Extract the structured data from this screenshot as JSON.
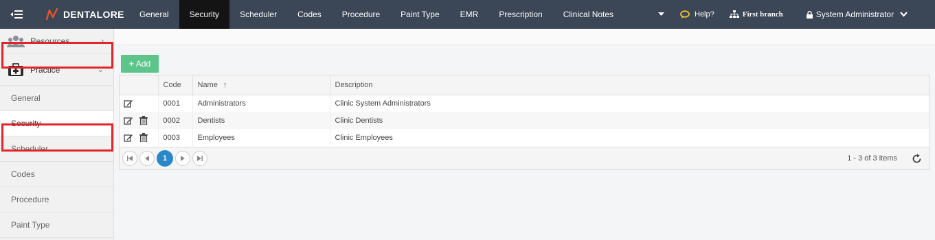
{
  "app": {
    "brand": "DENTALORE",
    "colors": {
      "topbar": "#3b4656",
      "active_tab": "#141414",
      "accent_green": "#5cc58a",
      "pager_active": "#2b88c8",
      "highlight": "#e3242b"
    }
  },
  "nav": {
    "tabs": [
      {
        "label": "General",
        "active": false
      },
      {
        "label": "Security",
        "active": true
      },
      {
        "label": "Scheduler",
        "active": false
      },
      {
        "label": "Codes",
        "active": false
      },
      {
        "label": "Procedure",
        "active": false
      },
      {
        "label": "Paint Type",
        "active": false
      },
      {
        "label": "EMR",
        "active": false
      },
      {
        "label": "Prescription",
        "active": false
      },
      {
        "label": "Clinical Notes",
        "active": false
      }
    ],
    "help_label": "Help?",
    "branch_label": "First branch",
    "user_label": "System Administrator"
  },
  "sidebar": {
    "groups": [
      {
        "label": "Resources",
        "icon": "users-icon",
        "expanded": false
      },
      {
        "label": "Practice",
        "icon": "medical-kit-icon",
        "expanded": true
      }
    ],
    "items": [
      {
        "label": "General",
        "active": false
      },
      {
        "label": "Security",
        "active": true
      },
      {
        "label": "Scheduler",
        "active": false
      },
      {
        "label": "Codes",
        "active": false
      },
      {
        "label": "Procedure",
        "active": false
      },
      {
        "label": "Paint Type",
        "active": false
      }
    ]
  },
  "main": {
    "add_label": "Add",
    "columns": [
      "Code",
      "Name",
      "Description"
    ],
    "sort": {
      "column": "Name",
      "direction": "ascending"
    },
    "rows": [
      {
        "code": "0001",
        "name": "Administrators",
        "description": "Clinic System Administrators",
        "deletable": false
      },
      {
        "code": "0002",
        "name": "Dentists",
        "description": "Clinic Dentists",
        "deletable": true
      },
      {
        "code": "0003",
        "name": "Employees",
        "description": "Clinic Employees",
        "deletable": true
      }
    ],
    "pager": {
      "current_page": "1",
      "info": "1 - 3 of 3 items"
    }
  }
}
